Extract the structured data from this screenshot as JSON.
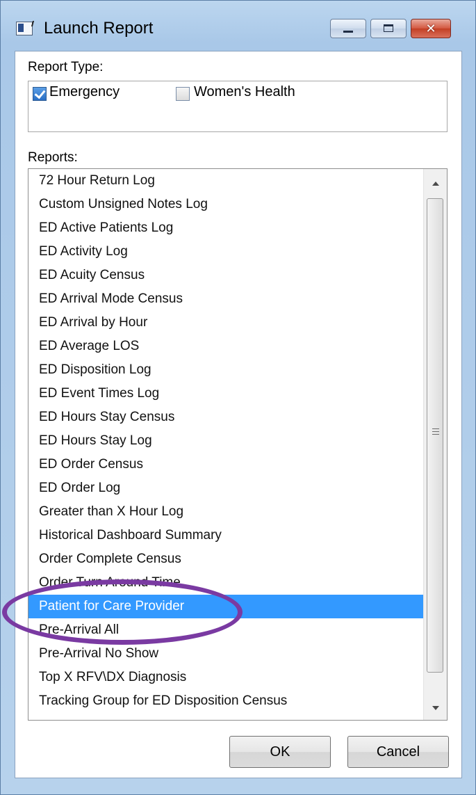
{
  "window": {
    "title": "Launch Report",
    "title_icon": "app-window-icon",
    "controls": [
      "minimize-icon",
      "maximize-icon",
      "close-icon"
    ],
    "close_glyph": "✕"
  },
  "report_type": {
    "label": "Report Type:",
    "options": [
      {
        "label": "Emergency",
        "checked": true
      },
      {
        "label": "Women's Health",
        "checked": false
      }
    ]
  },
  "reports": {
    "label": "Reports:",
    "selected_index": 18,
    "items": [
      "72 Hour Return Log",
      "Custom Unsigned Notes Log",
      "ED Active Patients Log",
      "ED Activity Log",
      "ED Acuity Census",
      "ED Arrival Mode Census",
      "ED Arrival by Hour",
      "ED Average LOS",
      "ED Disposition Log",
      "ED Event Times Log",
      "ED Hours Stay Census",
      "ED Hours Stay Log",
      "ED Order Census",
      "ED Order Log",
      "Greater than X Hour Log",
      "Historical Dashboard Summary",
      "Order Complete Census",
      "Order Turn Around Time",
      "Patient for Care Provider",
      "Pre-Arrival All",
      "Pre-Arrival No Show",
      "Top X RFV\\DX Diagnosis",
      "Tracking Group for ED Disposition Census"
    ]
  },
  "buttons": {
    "ok": "OK",
    "cancel": "Cancel"
  },
  "colors": {
    "selection": "#3399ff",
    "annotation": "#7a3aa2"
  }
}
